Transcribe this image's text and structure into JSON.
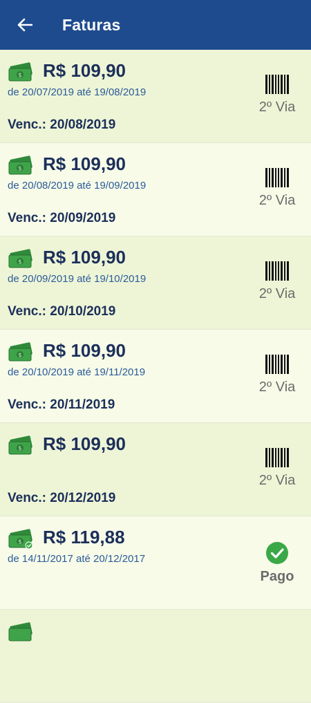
{
  "header": {
    "title": "Faturas"
  },
  "invoices": [
    {
      "amount": "R$ 109,90",
      "period": "de 20/07/2019 até 19/08/2019",
      "due": "Venc.: 20/08/2019",
      "action": "2º Via",
      "status": "open"
    },
    {
      "amount": "R$ 109,90",
      "period": "de 20/08/2019 até 19/09/2019",
      "due": "Venc.: 20/09/2019",
      "action": "2º Via",
      "status": "open"
    },
    {
      "amount": "R$ 109,90",
      "period": "de 20/09/2019 até 19/10/2019",
      "due": "Venc.: 20/10/2019",
      "action": "2º Via",
      "status": "open"
    },
    {
      "amount": "R$ 109,90",
      "period": "de 20/10/2019 até 19/11/2019",
      "due": "Venc.: 20/11/2019",
      "action": "2º Via",
      "status": "open"
    },
    {
      "amount": "R$ 109,90",
      "period": "",
      "due": "Venc.: 20/12/2019",
      "action": "2º Via",
      "status": "open"
    },
    {
      "amount": "R$ 119,88",
      "period": "de 14/11/2017 até 20/12/2017",
      "due": "",
      "action": "Pago",
      "status": "paid"
    }
  ],
  "icons": {
    "back": "arrow-left-icon",
    "money": "money-icon",
    "barcode": "barcode-icon",
    "paid": "check-circle-icon"
  },
  "colors": {
    "appbar": "#1e4b8e",
    "amount": "#1c2f5a",
    "period": "#2b5b9a",
    "money_green": "#3a9a3f",
    "paid_green": "#3aa847"
  }
}
